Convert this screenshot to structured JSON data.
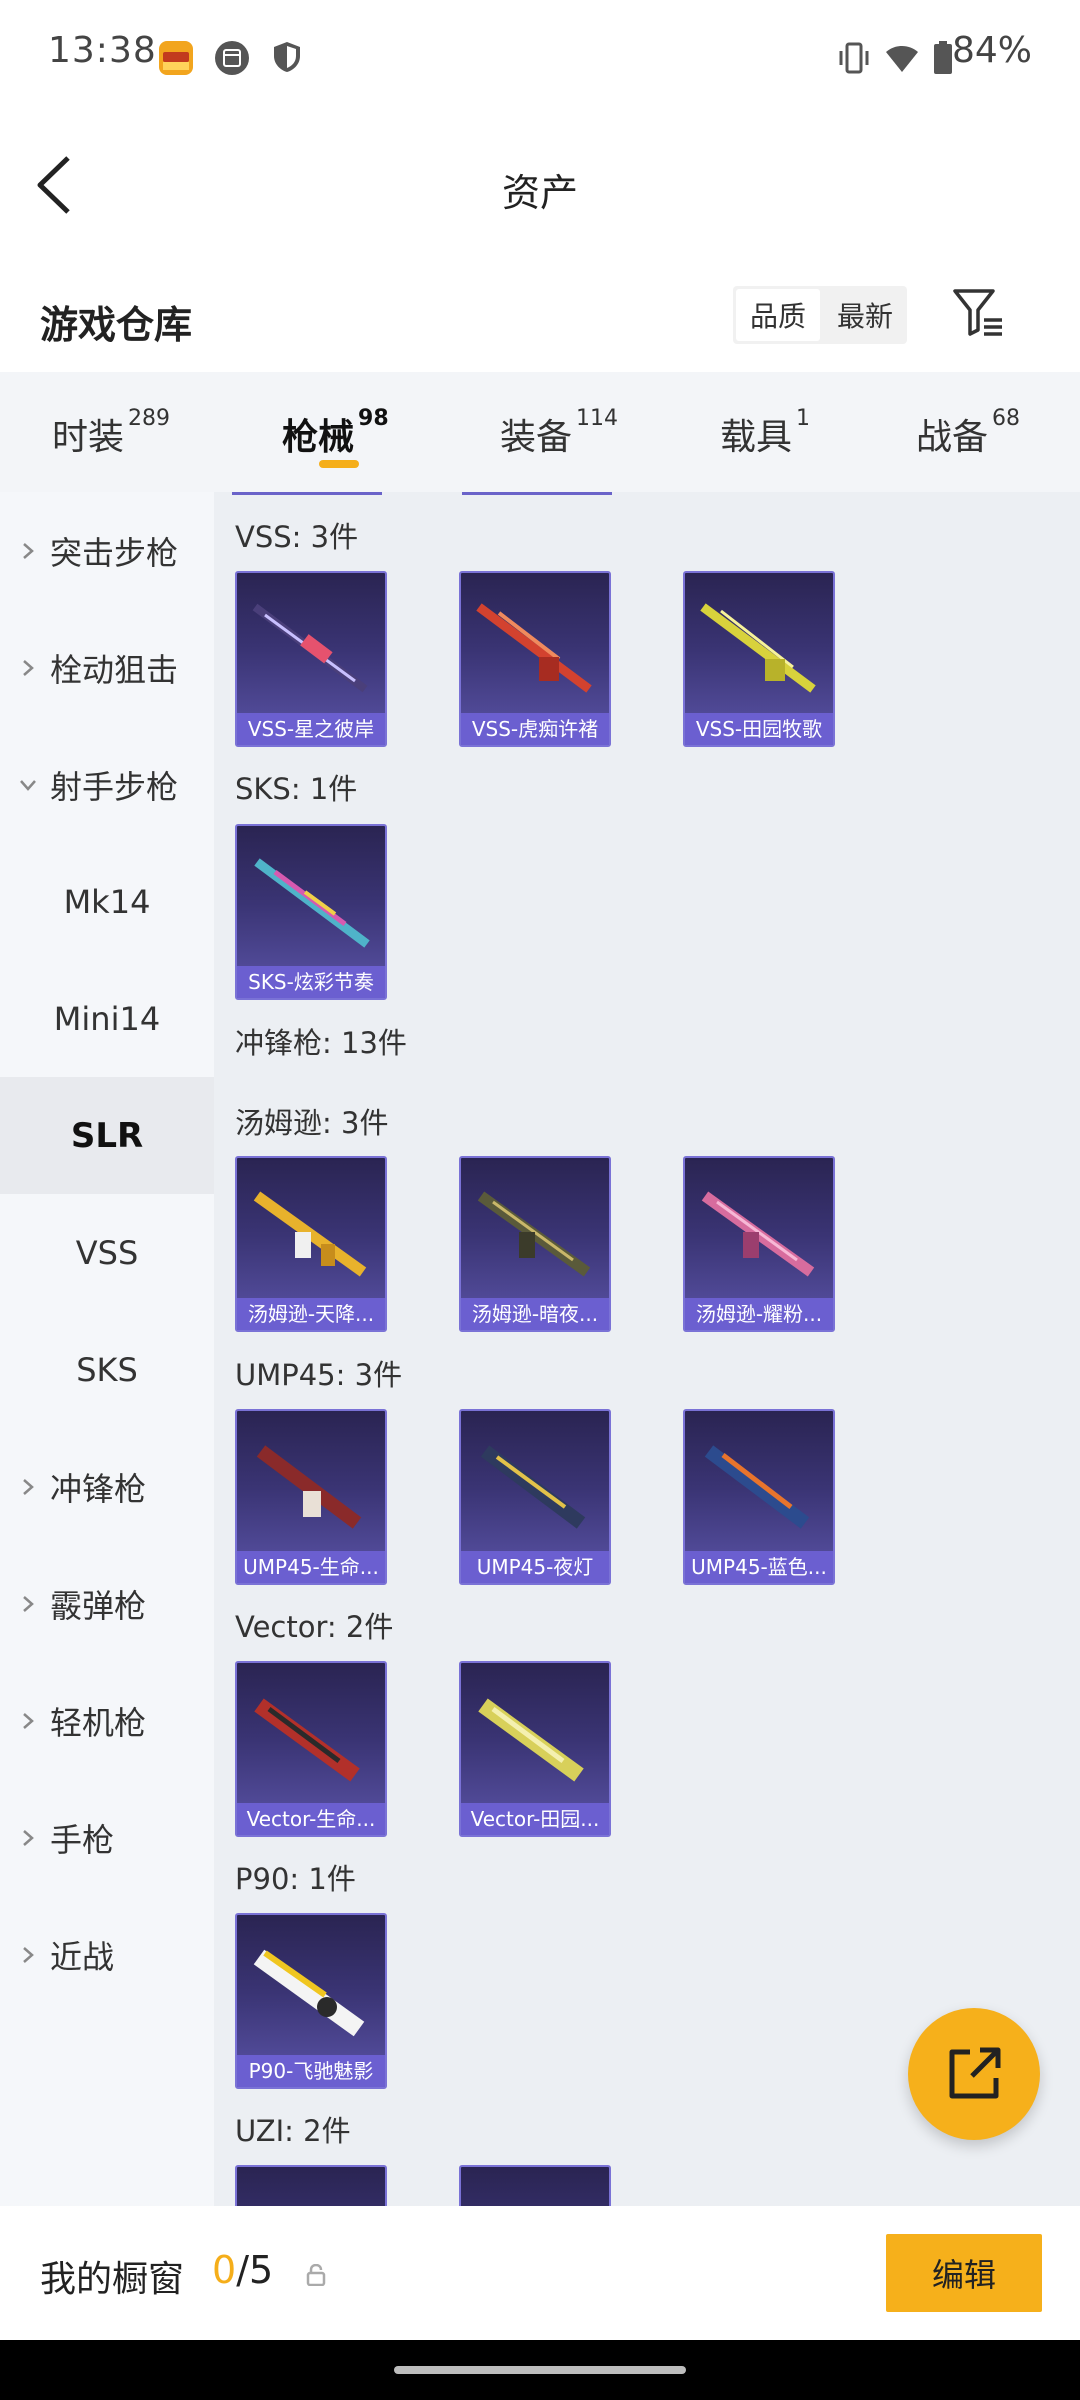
{
  "status_bar": {
    "time": "13:38",
    "battery": "84%"
  },
  "header": {
    "title": "资产"
  },
  "section": {
    "title": "游戏仓库",
    "sort_options": [
      "品质",
      "最新"
    ]
  },
  "tabs": [
    {
      "label": "时装",
      "count": "289"
    },
    {
      "label": "枪械",
      "count": "98"
    },
    {
      "label": "装备",
      "count": "114"
    },
    {
      "label": "载具",
      "count": "1"
    },
    {
      "label": "战备",
      "count": "68"
    }
  ],
  "sidebar": [
    {
      "label": "突击步枪",
      "type": "category",
      "expanded": false
    },
    {
      "label": "栓动狙击",
      "type": "category",
      "expanded": false
    },
    {
      "label": "射手步枪",
      "type": "category",
      "expanded": true
    },
    {
      "label": "Mk14",
      "type": "sub"
    },
    {
      "label": "Mini14",
      "type": "sub"
    },
    {
      "label": "SLR",
      "type": "sub",
      "selected": true
    },
    {
      "label": "VSS",
      "type": "sub"
    },
    {
      "label": "SKS",
      "type": "sub"
    },
    {
      "label": "冲锋枪",
      "type": "category",
      "expanded": false
    },
    {
      "label": "霰弹枪",
      "type": "category",
      "expanded": false
    },
    {
      "label": "轻机枪",
      "type": "category",
      "expanded": false
    },
    {
      "label": "手枪",
      "type": "category",
      "expanded": false
    },
    {
      "label": "近战",
      "type": "category",
      "expanded": false
    }
  ],
  "content": {
    "groups": [
      {
        "label": "VSS: 3件",
        "items": [
          "VSS-星之彼岸",
          "VSS-虎痴许褚",
          "VSS-田园牧歌"
        ]
      },
      {
        "label": "SKS: 1件",
        "items": [
          "SKS-炫彩节奏"
        ]
      },
      {
        "label": "冲锋枪: 13件",
        "items": []
      },
      {
        "label": "汤姆逊: 3件",
        "items": [
          "汤姆逊-天降...",
          "汤姆逊-暗夜...",
          "汤姆逊-耀粉..."
        ]
      },
      {
        "label": "UMP45: 3件",
        "items": [
          "UMP45-生命...",
          "UMP45-夜灯",
          "UMP45-蓝色..."
        ]
      },
      {
        "label": "Vector: 2件",
        "items": [
          "Vector-生命...",
          "Vector-田园..."
        ]
      },
      {
        "label": "P90: 1件",
        "items": [
          "P90-飞驰魅影"
        ]
      },
      {
        "label": "UZI: 2件",
        "items": [
          "",
          ""
        ]
      }
    ]
  },
  "bottom_bar": {
    "label": "我的橱窗",
    "count": "0",
    "total": "/5",
    "edit_label": "编辑"
  },
  "colors": {
    "accent": "#f6b01b",
    "card_caption": "#6b5fd0",
    "card_bg": "#2a2452"
  },
  "icons": {
    "back": "back-arrow-icon",
    "filter": "filter-icon",
    "share": "external-link-icon",
    "lock": "lock-icon"
  }
}
